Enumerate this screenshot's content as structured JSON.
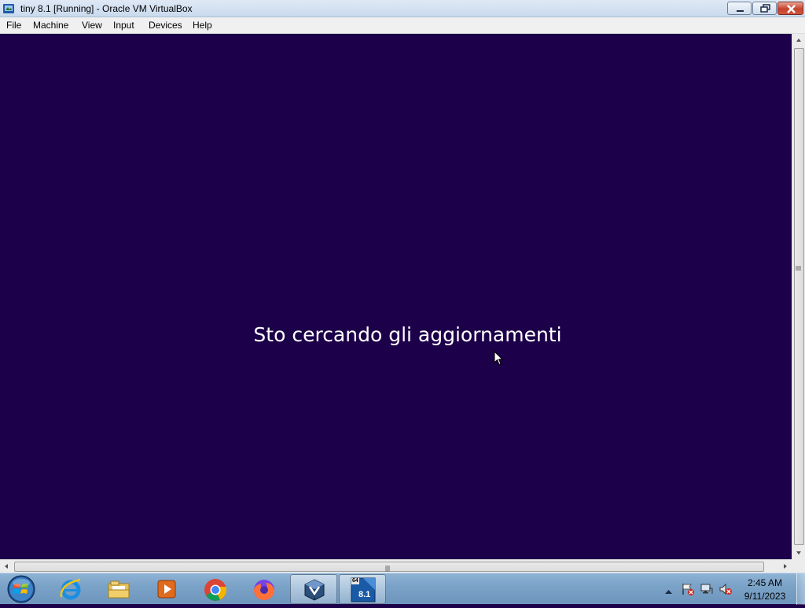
{
  "window": {
    "title": "tiny 8.1 [Running] - Oracle VM VirtualBox",
    "icon": "virtualbox-app-icon",
    "buttons": [
      "minimize",
      "maximize",
      "close"
    ]
  },
  "menubar": {
    "items": [
      {
        "label": "File"
      },
      {
        "label": "Machine"
      },
      {
        "label": "View"
      },
      {
        "label": "Input"
      },
      {
        "label": "Devices"
      },
      {
        "label": "Help"
      }
    ]
  },
  "vm": {
    "background_color": "#1c0049",
    "status_message": "Sto cercando gli aggiornamenti"
  },
  "taskbar": {
    "start_button": "windows-orb-icon",
    "pinned": [
      {
        "name": "internet-explorer",
        "active": false
      },
      {
        "name": "file-explorer",
        "active": false
      },
      {
        "name": "media-player",
        "active": false
      },
      {
        "name": "chrome",
        "active": false
      },
      {
        "name": "firefox",
        "active": false
      },
      {
        "name": "virtualbox",
        "active": true
      },
      {
        "name": "vm-window-tiny81",
        "active": true
      }
    ],
    "vm_taskbar_label": "8.1",
    "vm_taskbar_sublabel": "64",
    "tray": {
      "icons": [
        "action-center-flag-icon",
        "network-icon",
        "volume-muted-icon"
      ],
      "time": "2:45 AM",
      "date": "9/11/2023"
    }
  }
}
